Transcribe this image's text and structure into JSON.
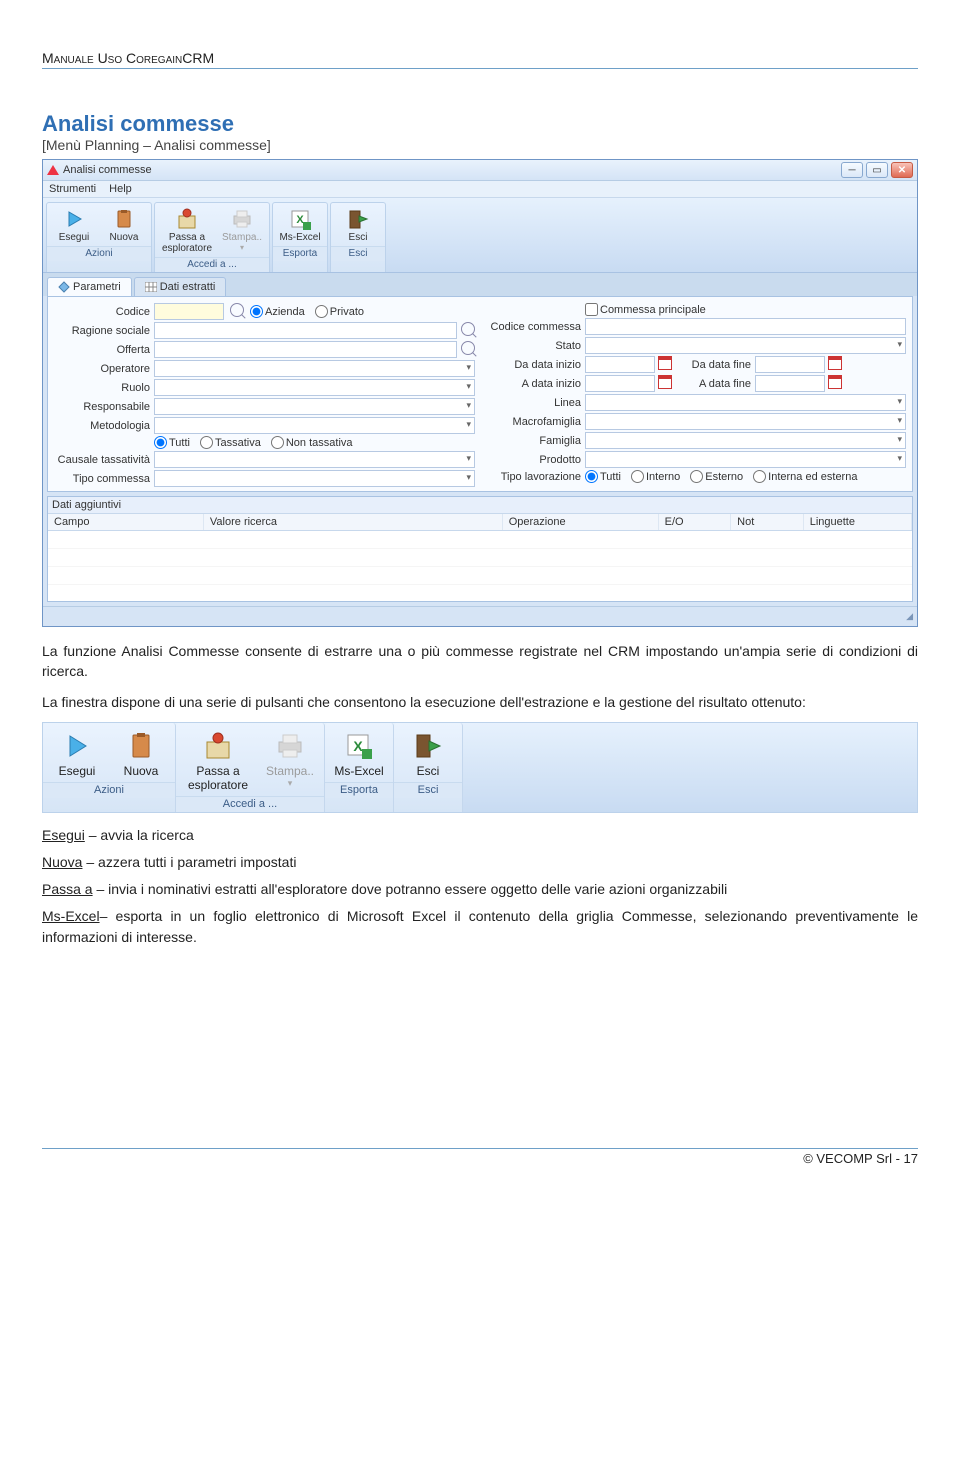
{
  "doc": {
    "topcap": "Manuale Uso CoregainCRM",
    "title": "Analisi commesse",
    "subtitle": "[Menù Planning – Analisi commesse]",
    "para1": "La funzione Analisi Commesse consente di estrarre una o più commesse registrate nel CRM impostando un'ampia serie di condizioni di ricerca.",
    "para2": "La finestra dispone di una serie di pulsanti che consentono la esecuzione dell'estrazione e la gestione del risultato ottenuto:",
    "defs": [
      {
        "u": "Esegui",
        "t": " – avvia la ricerca"
      },
      {
        "u": "Nuova",
        "t": " – azzera tutti i parametri impostati"
      },
      {
        "u": "Passa a",
        "t": " – invia i nominativi estratti all'esploratore dove potranno essere oggetto delle varie azioni organizzabili"
      },
      {
        "u": "Ms-Excel",
        "t": "– esporta in un foglio elettronico di Microsoft Excel il contenuto della griglia Commesse, selezionando preventivamente le informazioni di interesse."
      }
    ],
    "footer": "© VECOMP Srl - 17"
  },
  "win": {
    "title": "Analisi commesse",
    "menu": [
      "Strumenti",
      "Help"
    ]
  },
  "toolbar": {
    "groups": [
      {
        "cap": "Azioni",
        "btns": [
          {
            "l": "Esegui"
          },
          {
            "l": "Nuova"
          }
        ]
      },
      {
        "cap": "Accedi a ...",
        "btns": [
          {
            "l": "Passa a esploratore"
          },
          {
            "l": "Stampa..",
            "disabled": true
          }
        ]
      },
      {
        "cap": "Esporta",
        "btns": [
          {
            "l": "Ms-Excel"
          }
        ]
      },
      {
        "cap": "Esci",
        "btns": [
          {
            "l": "Esci"
          }
        ]
      }
    ]
  },
  "tabs": {
    "active": "Parametri",
    "inactive": "Dati estratti"
  },
  "form": {
    "left_labels": [
      "Codice",
      "Ragione sociale",
      "Offerta",
      "Operatore",
      "Ruolo",
      "Responsabile",
      "Metodologia",
      "",
      "Causale tassatività",
      "Tipo commessa"
    ],
    "radios1": [
      "Azienda",
      "Privato"
    ],
    "radios2": [
      "Tutti",
      "Tassativa",
      "Non tassativa"
    ],
    "right_labels": [
      "",
      "Codice commessa",
      "Stato",
      "Da data inizio",
      "A data inizio",
      "Linea",
      "Macrofamiglia",
      "Famiglia",
      "Prodotto",
      "Tipo lavorazione"
    ],
    "chk": "Commessa principale",
    "date_pair": [
      "Da data fine",
      "A data fine"
    ],
    "tl": [
      "Tutti",
      "Interno",
      "Esterno",
      "Interna ed esterna"
    ]
  },
  "grid": {
    "title": "Dati aggiuntivi",
    "cols": [
      "Campo",
      "Valore ricerca",
      "Operazione",
      "E/O",
      "Not",
      "Linguette"
    ]
  }
}
